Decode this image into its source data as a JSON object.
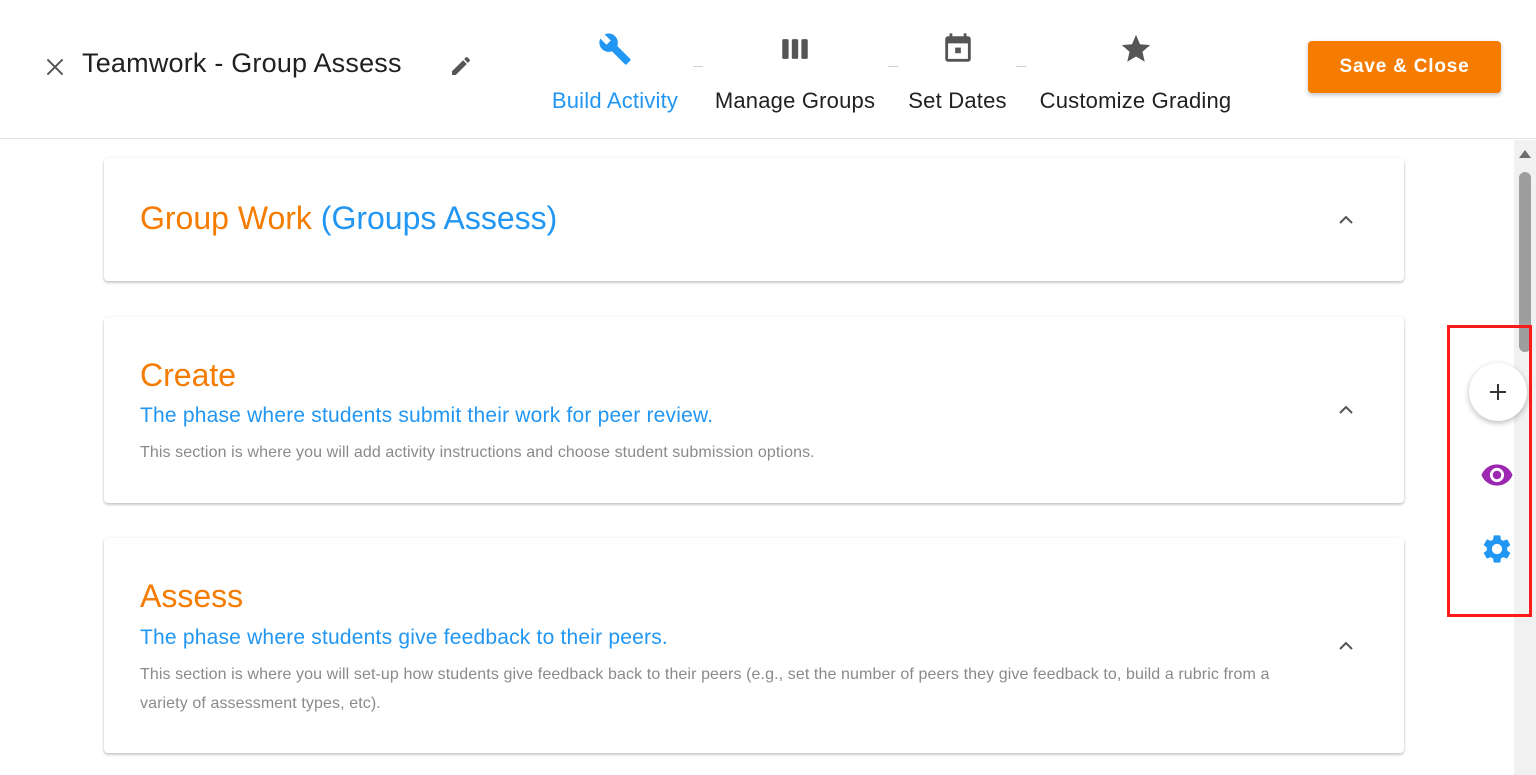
{
  "header": {
    "title": "Teamwork - Group Assess",
    "save_label": "Save & Close"
  },
  "steps": [
    {
      "label": "Build Activity",
      "icon": "wrench-icon",
      "active": true
    },
    {
      "label": "Manage Groups",
      "icon": "columns-icon",
      "active": false
    },
    {
      "label": "Set Dates",
      "icon": "calendar-icon",
      "active": false
    },
    {
      "label": "Customize Grading",
      "icon": "star-icon",
      "active": false
    }
  ],
  "sections": [
    {
      "title": "Group Work",
      "title_suffix": "(Groups Assess)"
    },
    {
      "title": "Create",
      "subtitle": "The phase where students submit their work for peer review.",
      "description": "This section is where you will add activity instructions and choose student submission options."
    },
    {
      "title": "Assess",
      "subtitle": "The phase where students give feedback to their peers.",
      "description": "This section is where you will set-up how students give feedback back to their peers (e.g., set the number of peers they give feedback to, build a rubric from a variety of assessment types, etc)."
    }
  ],
  "floating_tools": {
    "add_icon": "plus-icon",
    "preview_icon": "eye-icon",
    "settings_icon": "gear-icon"
  },
  "colors": {
    "accent_orange": "#f57c00",
    "accent_blue": "#2196f3",
    "preview_purple": "#9c27b0",
    "highlight_red": "#ff1a1a"
  }
}
